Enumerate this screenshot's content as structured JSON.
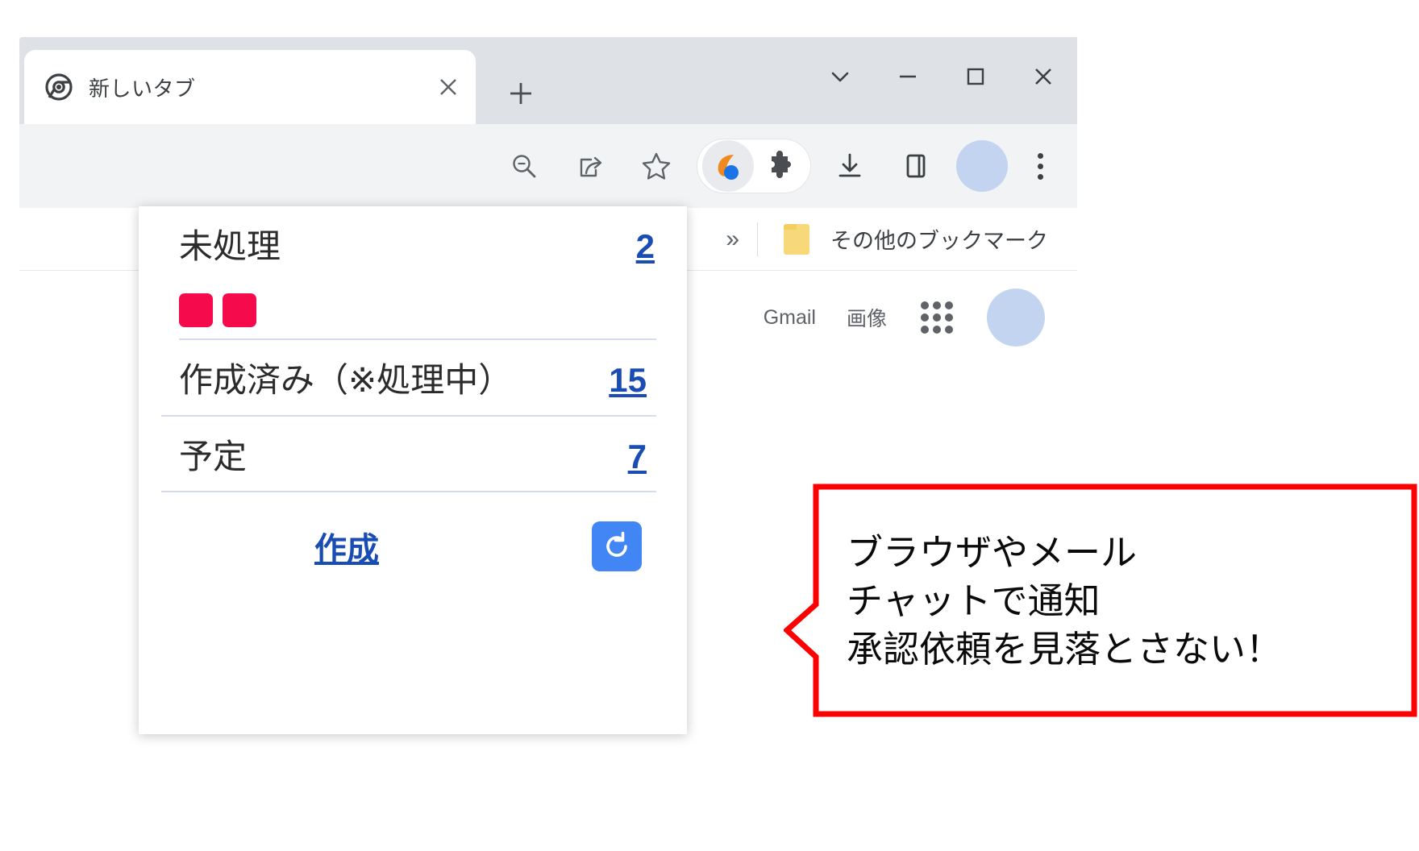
{
  "browser": {
    "tab": {
      "title": "新しいタブ",
      "favicon_icon": "chrome-logo-icon",
      "close_icon": "close-icon"
    },
    "new_tab_icon": "plus-icon",
    "window_controls": [
      {
        "name": "tab-search",
        "icon": "chevron-down-icon"
      },
      {
        "name": "minimize",
        "icon": "minimize-icon"
      },
      {
        "name": "maximize",
        "icon": "maximize-icon"
      },
      {
        "name": "close",
        "icon": "close-icon"
      }
    ],
    "toolbar_icons": [
      {
        "name": "zoom-out",
        "icon": "magnifier-minus-icon"
      },
      {
        "name": "share",
        "icon": "share-icon"
      },
      {
        "name": "bookmark",
        "icon": "star-icon"
      },
      {
        "name": "extension-app",
        "icon": "workflow-swoosh-icon"
      },
      {
        "name": "extensions",
        "icon": "puzzle-icon"
      },
      {
        "name": "downloads",
        "icon": "download-icon"
      },
      {
        "name": "side-panel",
        "icon": "side-panel-icon"
      },
      {
        "name": "profile",
        "icon": "avatar-icon"
      },
      {
        "name": "browser-menu",
        "icon": "three-dots-icon"
      }
    ],
    "bookmarks_bar": {
      "overflow_glyph": "»",
      "folder_icon": "folder-icon",
      "folder_label": "その他のブックマーク"
    },
    "new_tab_page": {
      "links": [
        "Gmail",
        "画像"
      ],
      "apps_icon": "apps-grid-icon",
      "avatar_icon": "account-avatar-icon"
    }
  },
  "popup": {
    "rows": [
      {
        "label": "未処理",
        "count": "2",
        "badges": 2
      },
      {
        "label": "作成済み（※処理中）",
        "count": "15",
        "badges": 0
      },
      {
        "label": "予定",
        "count": "7",
        "badges": 0
      }
    ],
    "create_label": "作成",
    "refresh_icon": "refresh-icon"
  },
  "callout": {
    "text": "ブラウザやメール\nチャットで通知\n承認依頼を見落とさない！",
    "border_color": "#FF0000",
    "fill_color": "#FFFFFF"
  },
  "colors": {
    "badge_red": "#F50B4C",
    "link_blue": "#1A4DB3",
    "button_blue": "#4285F4",
    "callout_red": "#FF0000"
  }
}
